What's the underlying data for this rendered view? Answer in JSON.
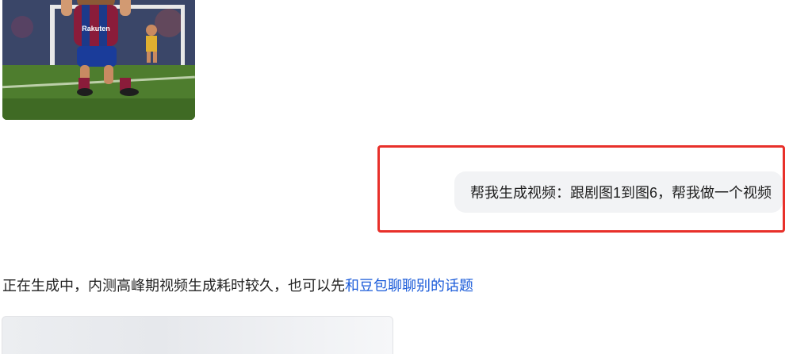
{
  "conversation": {
    "generated_image": {
      "alt": "",
      "jersey_text": "Rakuten"
    },
    "user_message": {
      "text": "帮我生成视频：跟剧图1到图6，帮我做一个视频"
    },
    "assistant_message": {
      "prefix": "正在生成中，内测高峰期视频生成耗时较久，也可以先",
      "link_text": "和豆包聊聊别的话题"
    }
  },
  "colors": {
    "highlight_border": "#e8302a",
    "link": "#1a5bd9",
    "bubble_bg": "#f2f3f5"
  }
}
